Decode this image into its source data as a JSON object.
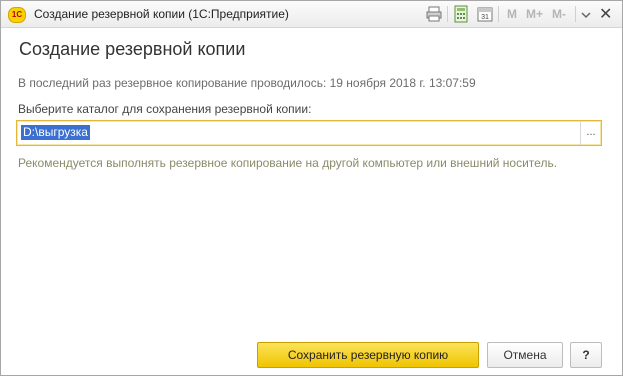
{
  "window": {
    "title": "Создание резервной копии  (1С:Предприятие)",
    "logo_text": "1С",
    "toolbar": [
      "M",
      "M+",
      "M-"
    ],
    "close_glyph": "✕"
  },
  "form": {
    "heading": "Создание резервной копии",
    "last_backup_info": "В последний раз резервное копирование проводилось: 19 ноября 2018 г. 13:07:59",
    "directory_label": "Выберите каталог для сохранения резервной копии:",
    "directory_value": "D:\\выгрузка",
    "select_button": "...",
    "recommendation": "Рекомендуется выполнять резервное копирование на другой компьютер или внешний носитель."
  },
  "buttons": {
    "save": "Сохранить резервную копию",
    "cancel": "Отмена",
    "help": "?"
  },
  "colors": {
    "accent": "#f0c400",
    "selection": "#3b6fd0"
  }
}
